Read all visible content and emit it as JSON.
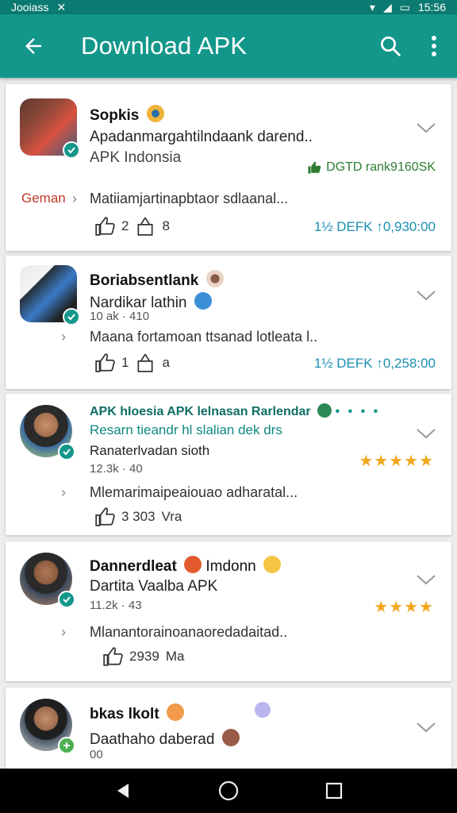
{
  "status_bar": {
    "left_text": "Jooiass",
    "time": "15:56"
  },
  "app_bar": {
    "title": "Download APK"
  },
  "cards": [
    {
      "name": "Sopkis",
      "subtitle": "Apadanmargahtilndaank darend..",
      "source": "APK Indonsia",
      "rank": "DGTD rank9160SK",
      "tag": "Geman",
      "description": "Matiiamjartinapbtaor sdlaanal...",
      "likes": "2",
      "shares": "8",
      "downloads": "1½ DEFK",
      "count": "↑0,930:00"
    },
    {
      "name": "Boriabsentlank",
      "subtitle": "Nardikar lathin",
      "meta": "10 ak · 410",
      "description": "Maana fortamoan ttsanad lotleata l..",
      "likes": "1",
      "shares": "a",
      "downloads": "1½ DEFK",
      "count": "↑0,258:00"
    },
    {
      "name": "APK hIoesia APK lelnasan Rarlendar",
      "subtitle": "Resarn tieandr hl slalian dek drs",
      "source": "Ranaterlvadan sioth",
      "meta": "12.3k · 40",
      "description": "Mlemarimaipeaiouao adharatal...",
      "likes": "3 303",
      "shares": "Vra",
      "rating": "★★★★★"
    },
    {
      "name": "Dannerdleat",
      "name2": "Imdonn",
      "subtitle": "Dartita Vaalba APK",
      "meta": "11.2k · 43",
      "description": "Mlanantorainoanaoredadaitad..",
      "likes": "2939",
      "shares": "Ma",
      "rating": "★★★★"
    },
    {
      "name": "bkas lkolt",
      "subtitle": "Daathaho daberad",
      "meta": "00"
    }
  ],
  "colors": {
    "primary": "#14978b",
    "status": "#0b7a70",
    "link": "#1a8fb0",
    "star": "#f2a71b",
    "rank": "#2e7d32"
  },
  "icons": [
    "back-arrow-icon",
    "search-icon",
    "more-vert-icon",
    "chevron-down-icon",
    "thumb-up-icon",
    "share-icon",
    "verified-icon",
    "star-icon",
    "nav-back-icon",
    "nav-home-icon",
    "nav-recents-icon"
  ]
}
